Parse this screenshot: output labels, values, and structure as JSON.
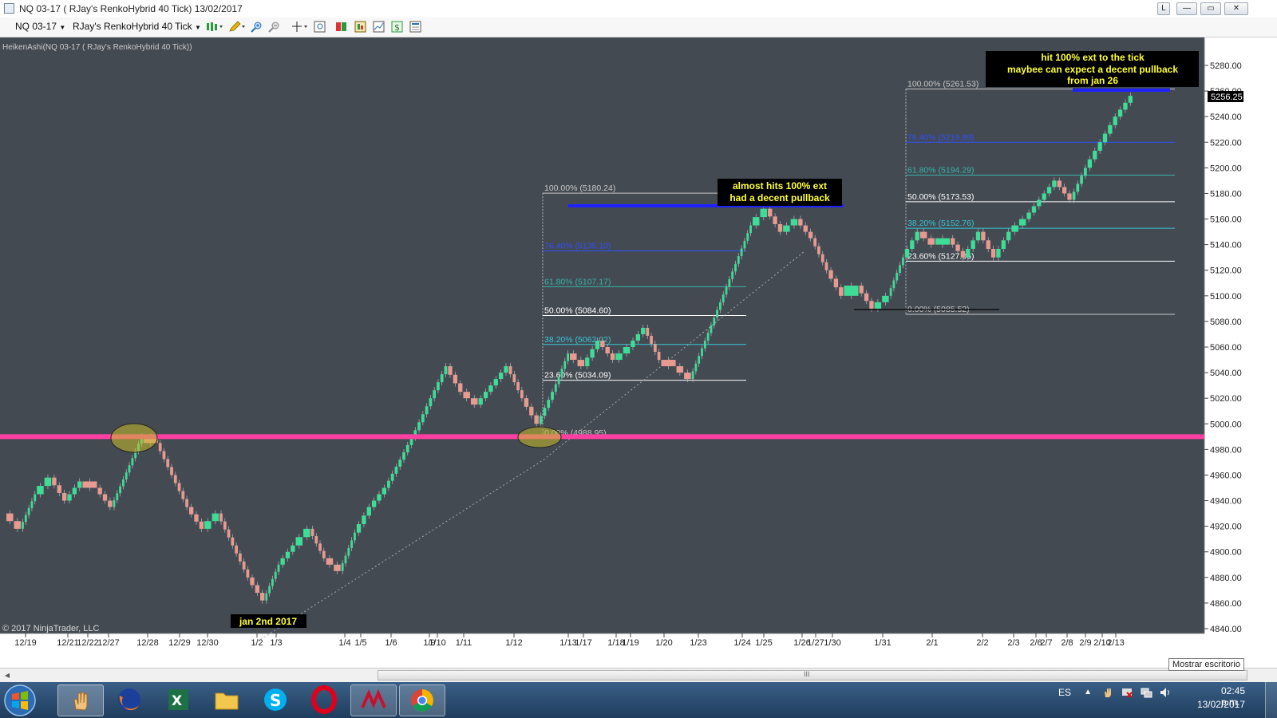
{
  "window": {
    "title": "NQ 03-17 ( RJay's RenkoHybrid  40 Tick)  13/02/2017",
    "buttons": {
      "restore_small": "L",
      "minimize": "—",
      "maximize": "▭",
      "close": "✕"
    }
  },
  "toolbar": {
    "instrument": "NQ 03-17",
    "period": "RJay's RenkoHybrid  40 Tick"
  },
  "chart": {
    "indicator_label": "HeikenAshi(NQ 03-17 ( RJay's RenkoHybrid  40 Tick))",
    "copyright": "© 2017 NinjaTrader, LLC",
    "last_price": "5256.25",
    "colors": {
      "background": "#444a52",
      "up": "#3ddc97",
      "down": "#e89a90",
      "level_line": "#ff3fa4",
      "annotation_bg": "#000000",
      "annotation_text": "#ffff33"
    }
  },
  "annotations": {
    "left_lines": [
      "almost hits 100% ext",
      "had a decent pullback"
    ],
    "right_lines": [
      "hit 100% ext to the tick",
      "maybee can expect a decent pullback",
      "from jan 26"
    ],
    "jan2": "jan 2nd  2017"
  },
  "fib_left": [
    {
      "label": "100.00% (5180.24)",
      "price": 5180.24,
      "color": "#c8c8c8"
    },
    {
      "label": "76.40% (5135.10)",
      "price": 5135.1,
      "color": "#3050ff"
    },
    {
      "label": "61.80% (5107.17)",
      "price": 5107.17,
      "color": "#35b5aa"
    },
    {
      "label": "50.00% (5084.60)",
      "price": 5084.6,
      "color": "#ffffff"
    },
    {
      "label": "38.20% (5062.02)",
      "price": 5062.02,
      "color": "#35c8d8"
    },
    {
      "label": "23.60% (5034.09)",
      "price": 5034.09,
      "color": "#ffffff"
    },
    {
      "label": "0.00% (4988.95)",
      "price": 4988.95,
      "color": "#c8c8c8"
    }
  ],
  "fib_right": [
    {
      "label": "100.00% (5261.53)",
      "price": 5261.53,
      "color": "#c8c8c8"
    },
    {
      "label": "76.40% (5219.99)",
      "price": 5219.99,
      "color": "#3050ff"
    },
    {
      "label": "61.80% (5194.29)",
      "price": 5194.29,
      "color": "#35b5aa"
    },
    {
      "label": "50.00% (5173.53)",
      "price": 5173.53,
      "color": "#ffffff"
    },
    {
      "label": "38.20% (5152.76)",
      "price": 5152.76,
      "color": "#35c8d8"
    },
    {
      "label": "23.60% (5127.06)",
      "price": 5127.06,
      "color": "#ffffff"
    },
    {
      "label": "0.00% (5085.52)",
      "price": 5085.52,
      "color": "#c8c8c8"
    }
  ],
  "chart_data": {
    "type": "line",
    "title": "",
    "ylim": [
      4840,
      5280
    ],
    "y_ticks": [
      4840,
      4860,
      4880,
      4900,
      4920,
      4940,
      4960,
      4980,
      5000,
      5020,
      5040,
      5060,
      5080,
      5100,
      5120,
      5140,
      5160,
      5180,
      5200,
      5220,
      5240,
      5260,
      5280
    ],
    "x_tick_labels": [
      "12/19",
      "12/21",
      "12/22",
      "12/27",
      "12/28",
      "12/29",
      "12/30",
      "1/2",
      "1/3",
      "1/4",
      "1/5",
      "1/6",
      "1/9",
      "1/10",
      "1/11",
      "1/12",
      "1/13",
      "1/17",
      "1/18",
      "1/19",
      "1/20",
      "1/23",
      "1/24",
      "1/25",
      "1/26",
      "1/27",
      "1/30",
      "1/31",
      "2/1",
      "2/2",
      "2/3",
      "2/6",
      "2/7",
      "2/8",
      "2/9",
      "2/10",
      "2/13"
    ],
    "horizontal_level": 4990,
    "series": [
      {
        "values": [
          4930,
          4918,
          4945,
          4958,
          4940,
          4955,
          4950,
          4935,
          4962,
          4990,
          4985,
          4960,
          4935,
          4918,
          4930,
          4905,
          4880,
          4862,
          4890,
          4905,
          4918,
          4895,
          4885,
          4915,
          4935,
          4950,
          4972,
          4995,
          5020,
          5045,
          5025,
          5015,
          5030,
          5045,
          5020,
          5000,
          5025,
          5055,
          5045,
          5065,
          5050,
          5060,
          5075,
          5050,
          5045,
          5035,
          5065,
          5095,
          5125,
          5155,
          5168,
          5150,
          5160,
          5145,
          5120,
          5100,
          5108,
          5090,
          5100,
          5130,
          5150,
          5140,
          5145,
          5130,
          5150,
          5130,
          5150,
          5160,
          5175,
          5190,
          5175,
          5200,
          5220,
          5240,
          5256.25
        ]
      }
    ]
  },
  "statusbar": {
    "tooltip": "Mostrar escritorio",
    "scroll_mark": "III",
    "left_arrow": "◂"
  },
  "taskbar": {
    "lang": "ES",
    "time": "02:45 p.m.",
    "date": "13/02/2017",
    "apps": [
      "hand-app",
      "firefox",
      "excel",
      "explorer",
      "skype",
      "opera",
      "ninjatrader",
      "chrome"
    ]
  }
}
